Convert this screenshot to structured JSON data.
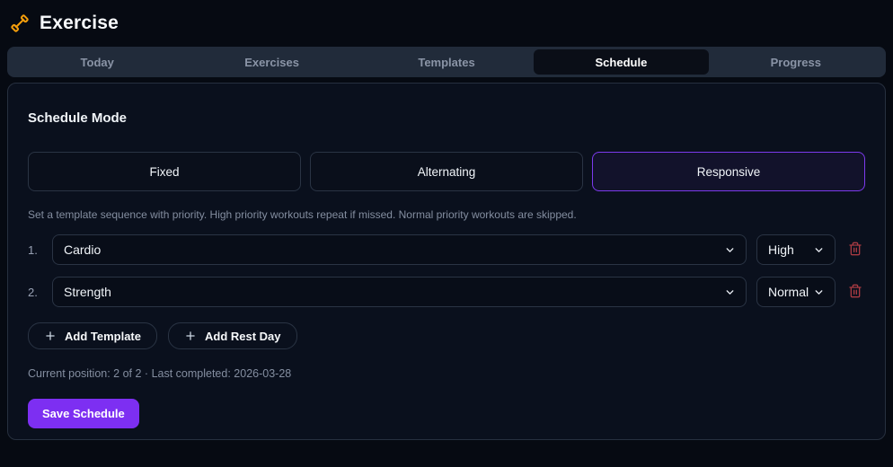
{
  "app": {
    "title": "Exercise",
    "logo_icon": "dumbbell-icon"
  },
  "tabs": [
    {
      "label": "Today",
      "active": false
    },
    {
      "label": "Exercises",
      "active": false
    },
    {
      "label": "Templates",
      "active": false
    },
    {
      "label": "Schedule",
      "active": true
    },
    {
      "label": "Progress",
      "active": false
    }
  ],
  "schedule": {
    "heading": "Schedule Mode",
    "modes": [
      {
        "label": "Fixed",
        "selected": false
      },
      {
        "label": "Alternating",
        "selected": false
      },
      {
        "label": "Responsive",
        "selected": true
      }
    ],
    "description": "Set a template sequence with priority. High priority workouts repeat if missed. Normal priority workouts are skipped.",
    "rows": [
      {
        "index": "1.",
        "template": "Cardio",
        "priority": "High"
      },
      {
        "index": "2.",
        "template": "Strength",
        "priority": "Normal"
      }
    ],
    "add_template_label": "Add Template",
    "add_rest_day_label": "Add Rest Day",
    "status": "Current position: 2 of 2 · Last completed: 2026-03-28",
    "save_label": "Save Schedule"
  },
  "colors": {
    "accent_purple": "#7c3aed",
    "save_button": "#7d2ff2",
    "danger_red": "#a83a42",
    "brand_orange": "#f59e0b",
    "page_background": "#060a12"
  }
}
